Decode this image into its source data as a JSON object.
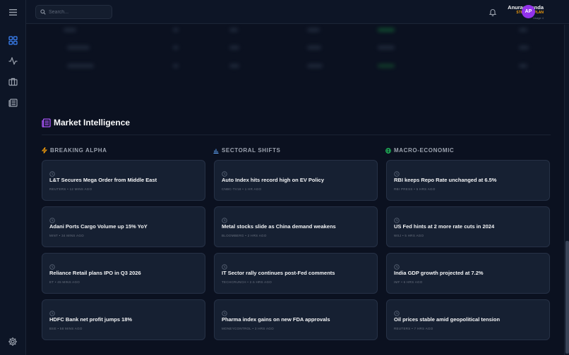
{
  "search": {
    "placeholder": "Search..."
  },
  "user": {
    "name": "Anurag Panda",
    "plan": "STUDENT PLAN",
    "usage": "Usage 4",
    "initials": "AP"
  },
  "section": {
    "title": "Market Intelligence"
  },
  "columns": [
    {
      "heading": "BREAKING ALPHA",
      "icon": "bolt-icon",
      "accent": "#f59e0b",
      "cards": [
        {
          "title": "L&T Secures Mega Order from Middle East",
          "source": "REUTERS",
          "time": "12 MINS AGO"
        },
        {
          "title": "Adani Ports Cargo Volume up 15% YoY",
          "source": "MINT",
          "time": "34 MINS AGO"
        },
        {
          "title": "Reliance Retail plans IPO in Q3 2026",
          "source": "ET",
          "time": "45 MINS AGO"
        },
        {
          "title": "HDFC Bank net profit jumps 18%",
          "source": "BSE",
          "time": "58 MINS AGO"
        }
      ]
    },
    {
      "heading": "SECTORAL SHIFTS",
      "icon": "bar-chart-icon",
      "accent": "#60a5fa",
      "cards": [
        {
          "title": "Auto Index hits record high on EV Policy",
          "source": "CNBC-TV18",
          "time": "1 HR AGO"
        },
        {
          "title": "Metal stocks slide as China demand weakens",
          "source": "BLOOMBERG",
          "time": "2 HRS AGO"
        },
        {
          "title": "IT Sector rally continues post-Fed comments",
          "source": "TECHCRUNCH",
          "time": "2.5 HRS AGO"
        },
        {
          "title": "Pharma index gains on new FDA approvals",
          "source": "MONEYCONTROL",
          "time": "3 HRS AGO"
        }
      ]
    },
    {
      "heading": "MACRO-ECONOMIC",
      "icon": "globe-icon",
      "accent": "#22c55e",
      "cards": [
        {
          "title": "RBI keeps Repo Rate unchanged at 6.5%",
          "source": "RBI PRESS",
          "time": "5 HRS AGO"
        },
        {
          "title": "US Fed hints at 2 more rate cuts in 2024",
          "source": "WSJ",
          "time": "5 HRS AGO"
        },
        {
          "title": "India GDP growth projected at 7.2%",
          "source": "IMF",
          "time": "6 HRS AGO"
        },
        {
          "title": "Oil prices stable amid geopolitical tension",
          "source": "REUTERS",
          "time": "7 HRS AGO"
        }
      ]
    }
  ],
  "colors": {
    "background": "#0b1120",
    "card": "#162032",
    "accent_purple": "#9333ea",
    "active_nav": "#3b82f6"
  }
}
